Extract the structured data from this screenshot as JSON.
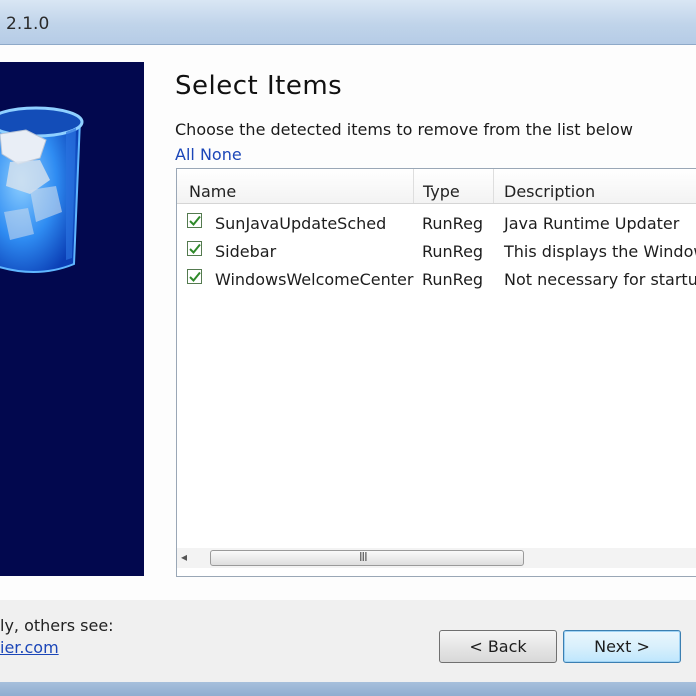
{
  "window": {
    "title": "2.1.0"
  },
  "page": {
    "heading": "Select Items",
    "instruction": "Choose the detected items to remove from the list below",
    "select_all": "All",
    "select_none": "None"
  },
  "list": {
    "columns": [
      "Name",
      "Type",
      "Description"
    ],
    "rows": [
      {
        "checked": true,
        "name": "SunJavaUpdateSched",
        "type": "RunReg",
        "description": "Java Runtime Updater"
      },
      {
        "checked": true,
        "name": "Sidebar",
        "type": "RunReg",
        "description": "This displays the Window"
      },
      {
        "checked": true,
        "name": "WindowsWelcomeCenter",
        "type": "RunReg",
        "description": "Not necessary for startu"
      }
    ],
    "scroll_left_icon": "◂",
    "scroll_grip_icon": "III"
  },
  "footer": {
    "text": "ly, others see:",
    "link": "ier.com"
  },
  "buttons": {
    "back": "< Back",
    "next": "Next >"
  },
  "colors": {
    "banner": "#02084e",
    "accent_link": "#1b46b8",
    "checkmark": "#2f8a2a"
  }
}
